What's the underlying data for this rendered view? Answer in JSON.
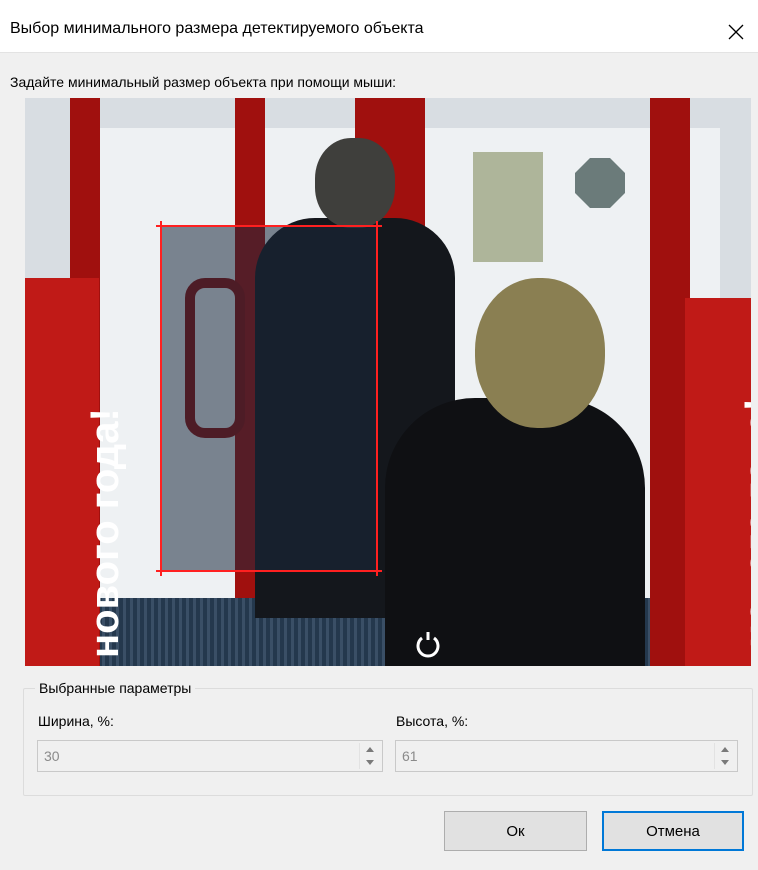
{
  "window": {
    "title": "Выбор минимального размера детектируемого объекта",
    "close_icon": "close-icon"
  },
  "instruction": "Задайте минимальный размер объекта при помощи мыши:",
  "video": {
    "banner_left": "нового года!",
    "banner_right": "нового года!"
  },
  "params": {
    "group_label": "Выбранные параметры",
    "width_label": "Ширина, %:",
    "width_value": "30",
    "height_label": "Высота, %:",
    "height_value": "61"
  },
  "buttons": {
    "ok_label": "Ок",
    "cancel_label": "Отмена"
  },
  "colors": {
    "selection_line": "#ff2020",
    "accent": "#0078d7"
  }
}
